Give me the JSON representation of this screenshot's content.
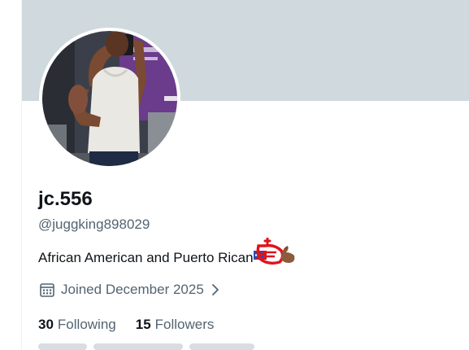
{
  "profile": {
    "display_name": "jc.556",
    "handle": "@juggking898029",
    "bio": "African American and Puerto Rican",
    "joined": "Joined December 2025",
    "following_count": "30",
    "following_label": "Following",
    "followers_count": "15",
    "followers_label": "Followers"
  },
  "icons": {
    "calendar": "calendar-icon",
    "chevron": "chevron-right-icon",
    "bio_emoji": "flag-emoji-icon"
  },
  "colors": {
    "banner": "#cfd9de",
    "primary_text": "#0f1419",
    "secondary_text": "#536471",
    "emoji_red": "#e0131f"
  }
}
